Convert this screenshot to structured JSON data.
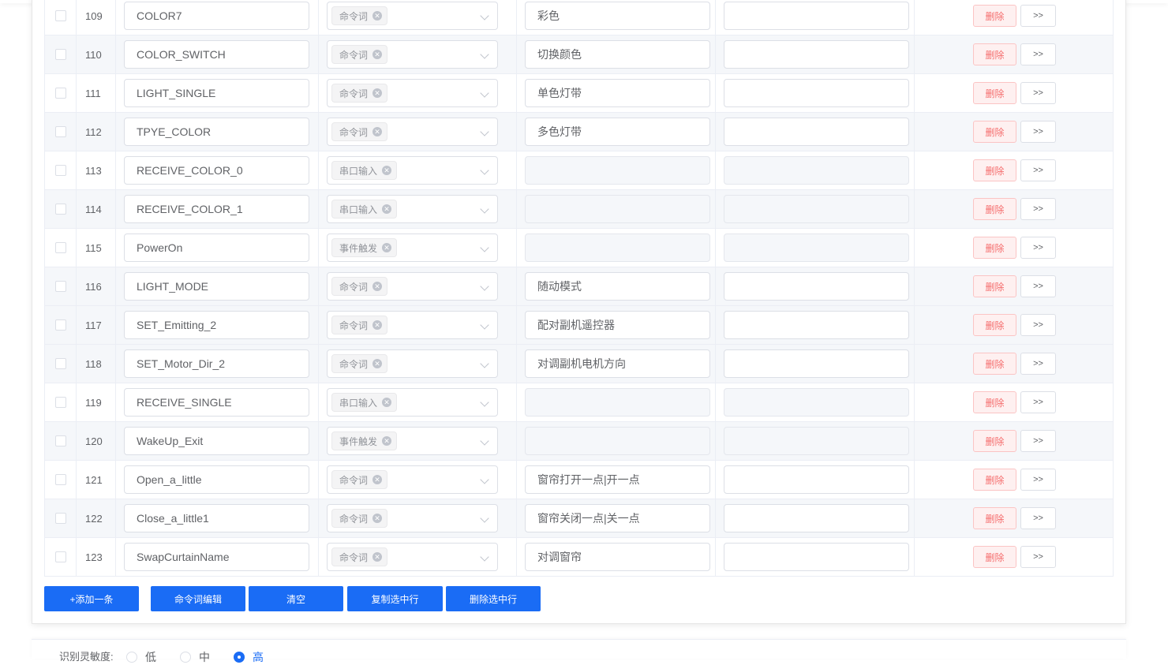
{
  "rows": [
    {
      "index": "109",
      "name": "COLOR7",
      "type": "命令词",
      "command": "彩色",
      "extra": ""
    },
    {
      "index": "110",
      "name": "COLOR_SWITCH",
      "type": "命令词",
      "command": "切换颜色",
      "extra": ""
    },
    {
      "index": "111",
      "name": "LIGHT_SINGLE",
      "type": "命令词",
      "command": "单色灯带",
      "extra": ""
    },
    {
      "index": "112",
      "name": "TPYE_COLOR",
      "type": "命令词",
      "command": "多色灯带",
      "extra": ""
    },
    {
      "index": "113",
      "name": "RECEIVE_COLOR_0",
      "type": "串口输入",
      "command": "",
      "extra": ""
    },
    {
      "index": "114",
      "name": "RECEIVE_COLOR_1",
      "type": "串口输入",
      "command": "",
      "extra": ""
    },
    {
      "index": "115",
      "name": "PowerOn",
      "type": "事件触发",
      "command": "",
      "extra": ""
    },
    {
      "index": "116",
      "name": "LIGHT_MODE",
      "type": "命令词",
      "command": "随动模式",
      "extra": ""
    },
    {
      "index": "117",
      "name": "SET_Emitting_2",
      "type": "命令词",
      "command": "配对副机遥控器",
      "extra": ""
    },
    {
      "index": "118",
      "name": "SET_Motor_Dir_2",
      "type": "命令词",
      "command": "对调副机电机方向",
      "extra": ""
    },
    {
      "index": "119",
      "name": "RECEIVE_SINGLE",
      "type": "串口输入",
      "command": "",
      "extra": ""
    },
    {
      "index": "120",
      "name": "WakeUp_Exit",
      "type": "事件触发",
      "command": "",
      "extra": ""
    },
    {
      "index": "121",
      "name": "Open_a_little",
      "type": "命令词",
      "command": "窗帘打开一点|开一点",
      "extra": ""
    },
    {
      "index": "122",
      "name": "Close_a_little1",
      "type": "命令词",
      "command": "窗帘关闭一点|关一点",
      "extra": ""
    },
    {
      "index": "123",
      "name": "SwapCurtainName",
      "type": "命令词",
      "command": "对调窗帘",
      "extra": ""
    }
  ],
  "row_actions": {
    "delete_label": "删除",
    "more_label": ">>"
  },
  "actions": {
    "add": "+添加一条",
    "edit_commands": "命令词编辑",
    "clear": "清空",
    "copy_selected": "复制选中行",
    "delete_selected": "删除选中行"
  },
  "sensitivity": {
    "label": "识别灵敏度:",
    "options": [
      "低",
      "中",
      "高"
    ],
    "selected": "高"
  },
  "colors": {
    "primary": "#1a6cf5",
    "danger": "#f56c6c"
  }
}
